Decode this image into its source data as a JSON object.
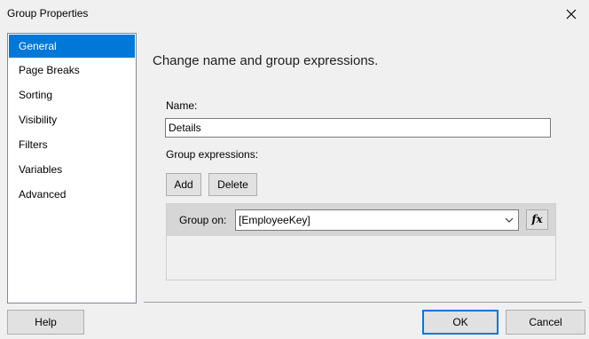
{
  "window": {
    "title": "Group Properties",
    "close_icon": "close-icon"
  },
  "nav": {
    "items": [
      {
        "label": "General",
        "selected": true
      },
      {
        "label": "Page Breaks",
        "selected": false
      },
      {
        "label": "Sorting",
        "selected": false
      },
      {
        "label": "Visibility",
        "selected": false
      },
      {
        "label": "Filters",
        "selected": false
      },
      {
        "label": "Variables",
        "selected": false
      },
      {
        "label": "Advanced",
        "selected": false
      }
    ]
  },
  "main": {
    "heading": "Change name and group expressions.",
    "name_label": "Name:",
    "name_value": "Details",
    "group_expressions_label": "Group expressions:",
    "add_label": "Add",
    "delete_label": "Delete",
    "group_on_label": "Group on:",
    "group_on_value": "[EmployeeKey]",
    "fx_label": "fx"
  },
  "footer": {
    "help_label": "Help",
    "ok_label": "OK",
    "cancel_label": "Cancel"
  },
  "colors": {
    "accent": "#0078d7",
    "background": "#f0f0f0"
  }
}
